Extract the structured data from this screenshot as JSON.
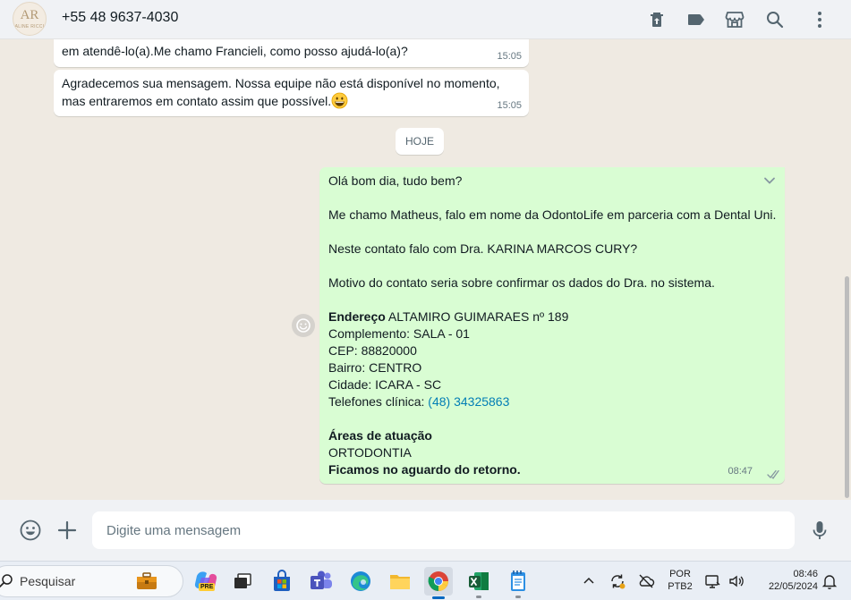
{
  "header": {
    "contact_name": "+55 48 9637-4030",
    "avatar_mark": "AR",
    "avatar_subtext": "ALINE RICCI",
    "icons": [
      "delete-icon",
      "label-icon",
      "store-icon",
      "search-icon",
      "menu-icon"
    ]
  },
  "messages": {
    "incoming": [
      {
        "lines": [
          "em atendê-lo(a).Me chamo Francieli, como posso ajudá-lo(a)?"
        ],
        "time": "15:05"
      },
      {
        "lines": [
          "Agradecemos sua mensagem. Nossa equipe não está disponível no momento,",
          "mas entraremos em contato assim que possível."
        ],
        "time": "15:05",
        "emoji": "grinning-face"
      }
    ],
    "date_divider": "HOJE",
    "outgoing": {
      "greeting": "Olá bom dia, tudo bem?",
      "intro": "Me chamo Matheus, falo em nome da OdontoLife em parceria com a Dental Uni.",
      "question": "Neste contato falo com Dra. KARINA MARCOS CURY?",
      "reason": "Motivo do contato seria sobre confirmar os dados do Dra. no sistema.",
      "address_label": "Endereço",
      "address_value": " ALTAMIRO GUIMARAES nº 189",
      "complemento": "Complemento: SALA - 01",
      "cep": "CEP: 88820000",
      "bairro": "Bairro: CENTRO",
      "cidade": "Cidade: ICARA - SC",
      "phone_label": "Telefones clínica: ",
      "phone_value": "(48) 34325863",
      "areas_label": "Áreas de atuação",
      "areas_value": "ORTODONTIA",
      "closing": "Ficamos no aguardo do retorno.",
      "time": "08:47",
      "status": "delivered"
    }
  },
  "composer": {
    "placeholder": "Digite uma mensagem",
    "icons": [
      "emoji-icon",
      "attach-plus-icon",
      "microphone-icon"
    ]
  },
  "taskbar": {
    "search_label": "Pesquisar",
    "pre_badge": "PRE",
    "apps": [
      "briefcase",
      "copilot",
      "task-view",
      "microsoft-store",
      "teams",
      "edge",
      "file-explorer",
      "chrome",
      "excel",
      "notepad"
    ],
    "lang_top": "POR",
    "lang_bottom": "PTB2",
    "time": "08:46",
    "date": "22/05/2024"
  },
  "colors": {
    "chat_bg": "#efeae2",
    "outgoing_bubble": "#d9fdd3",
    "incoming_bubble": "#ffffff",
    "header_bg": "#f0f2f5",
    "link": "#027eb5"
  }
}
